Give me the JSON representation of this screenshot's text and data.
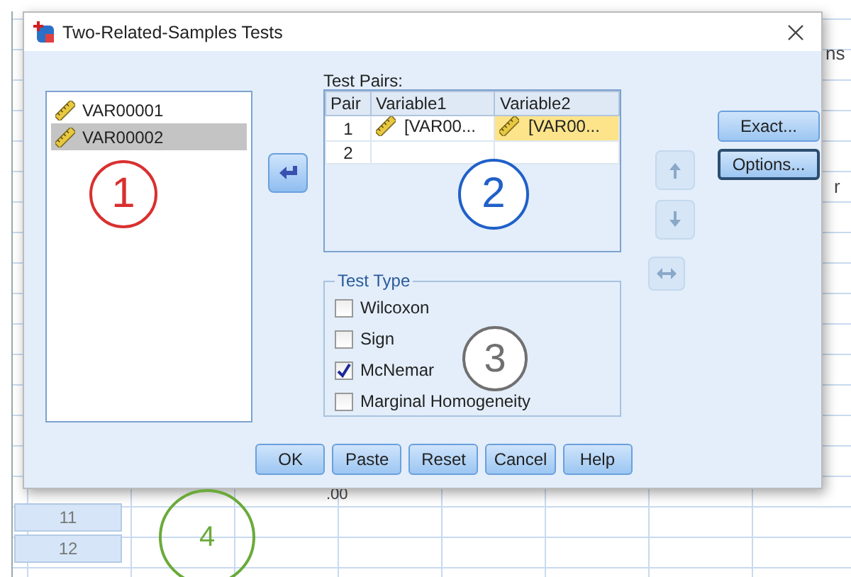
{
  "background": {
    "toolbar_fragment": "ns",
    "column_fragment": "r",
    "cell_fragment": ".00",
    "row_headers": [
      "11",
      "12"
    ]
  },
  "dialog": {
    "title": "Two-Related-Samples Tests",
    "variables": [
      {
        "name": "VAR00001",
        "selected": false
      },
      {
        "name": "VAR00002",
        "selected": true
      }
    ],
    "move_button": {
      "disabled": false
    },
    "test_pairs": {
      "label": "Test Pairs:",
      "columns": [
        "Pair",
        "Variable1",
        "Variable2"
      ],
      "rows": [
        {
          "cells": [
            {
              "kind": "number",
              "text": "1",
              "selected": false
            },
            {
              "kind": "variable",
              "text": "[VAR00...",
              "selected": false
            },
            {
              "kind": "variable",
              "text": "[VAR00...",
              "selected": true
            }
          ]
        },
        {
          "cells": [
            {
              "kind": "number",
              "text": "2",
              "selected": false
            },
            {
              "kind": "empty",
              "selected": false
            },
            {
              "kind": "empty",
              "selected": false
            }
          ]
        }
      ]
    },
    "order_buttons": [
      {
        "kind": "up",
        "disabled": true
      },
      {
        "kind": "down",
        "disabled": true
      },
      {
        "kind": "swap",
        "disabled": true
      }
    ],
    "side_buttons": [
      {
        "label": "Exact...",
        "focused": false
      },
      {
        "label": "Options...",
        "focused": true
      }
    ],
    "test_type": {
      "legend": "Test Type",
      "options": [
        {
          "label": "Wilcoxon",
          "checked": false
        },
        {
          "label": "Sign",
          "checked": false
        },
        {
          "label": "McNemar",
          "checked": true
        },
        {
          "label": "Marginal Homogeneity",
          "checked": false
        }
      ]
    },
    "buttons": [
      {
        "label": "OK",
        "focused": false
      },
      {
        "label": "Paste",
        "focused": false
      },
      {
        "label": "Reset",
        "focused": false
      },
      {
        "label": "Cancel",
        "focused": false
      },
      {
        "label": "Help",
        "focused": false
      }
    ]
  },
  "annotations": [
    {
      "text": "1",
      "color": "#d93030"
    },
    {
      "text": "2",
      "color": "#2060c8"
    },
    {
      "text": "3",
      "color": "#707070"
    },
    {
      "text": "4",
      "color": "#6aaa3a"
    }
  ]
}
